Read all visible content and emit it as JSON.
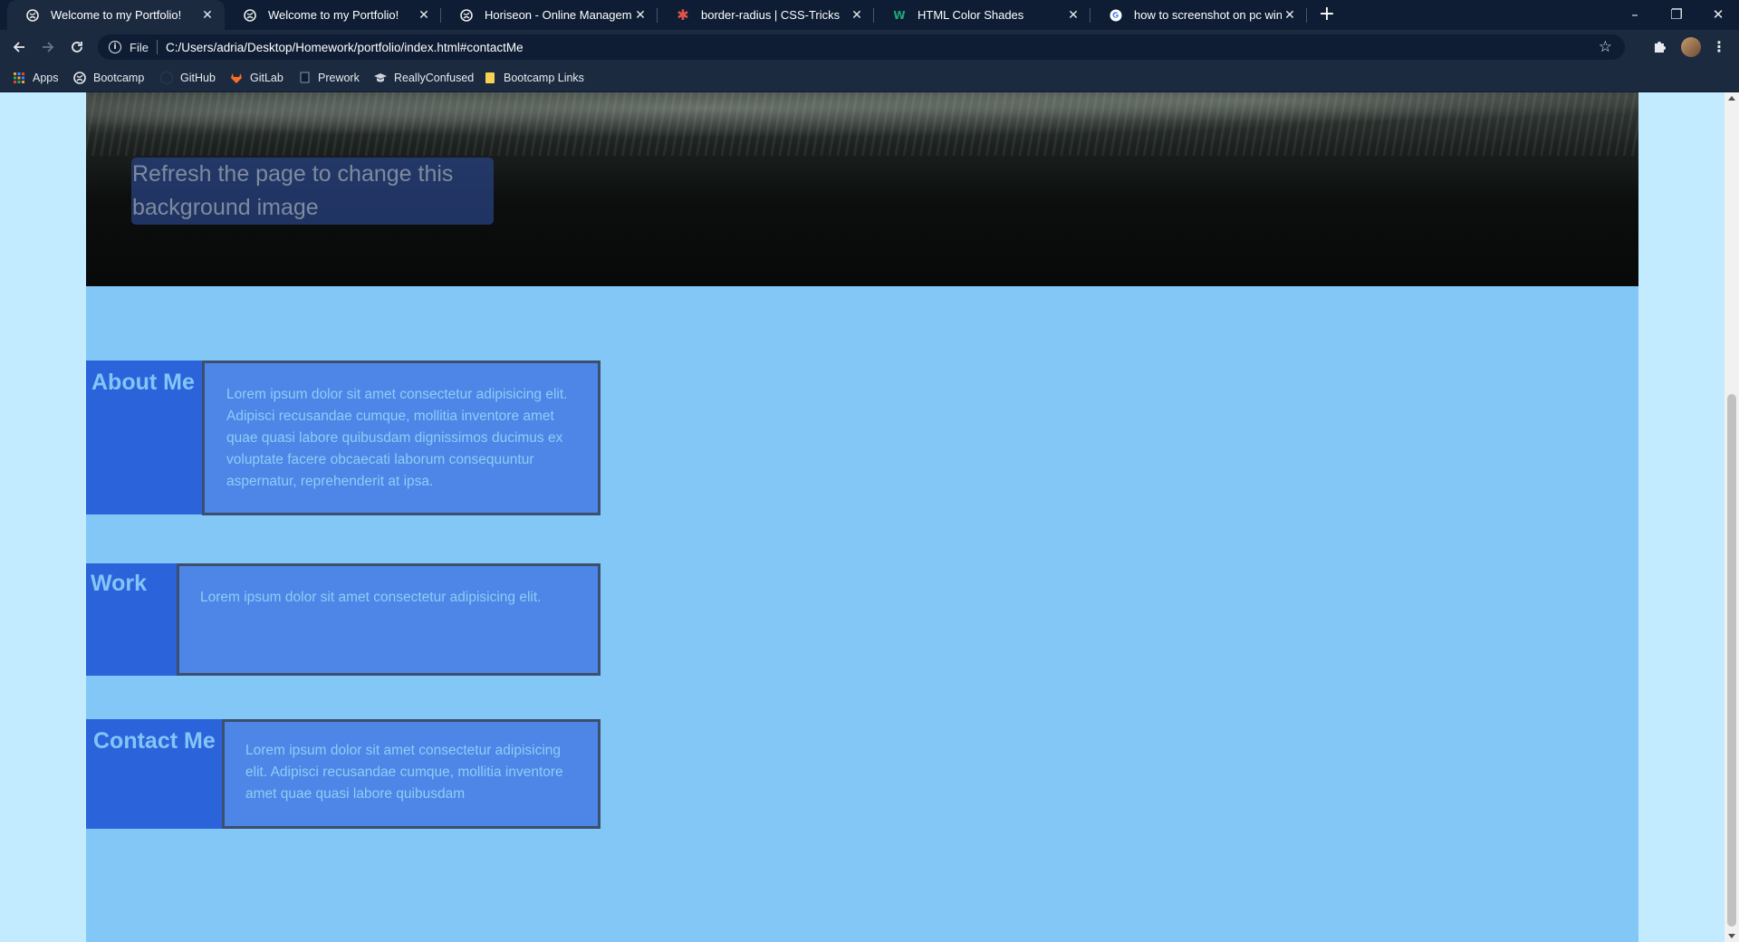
{
  "browser": {
    "tabs": [
      {
        "title": "Welcome to my Portfolio!",
        "icon": "globe-icon",
        "active": true
      },
      {
        "title": "Welcome to my Portfolio!",
        "icon": "globe-icon",
        "active": false
      },
      {
        "title": "Horiseon - Online Management a",
        "icon": "globe-icon",
        "active": false
      },
      {
        "title": "border-radius | CSS-Tricks",
        "icon": "css-tricks-star-icon",
        "active": false
      },
      {
        "title": "HTML Color Shades",
        "icon": "w-logo-icon",
        "active": false
      },
      {
        "title": "how to screenshot on pc window",
        "icon": "google-g-icon",
        "active": false
      }
    ],
    "new_tab": "+",
    "window_controls": {
      "minimize": "–",
      "restore": "❐",
      "close": "✕"
    },
    "address": {
      "scheme_label": "File",
      "url": "C:/Users/adria/Desktop/Homework/portfolio/index.html#contactMe"
    },
    "bookmarks": [
      {
        "label": "Apps",
        "icon": "apps-grid-icon"
      },
      {
        "label": "Bootcamp",
        "icon": "globe-icon"
      },
      {
        "label": "GitHub",
        "icon": "github-icon"
      },
      {
        "label": "GitLab",
        "icon": "gitlab-icon"
      },
      {
        "label": "Prework",
        "icon": "book-icon"
      },
      {
        "label": "ReallyConfused",
        "icon": "graduation-cap-icon"
      },
      {
        "label": "Bootcamp Links",
        "icon": "folder-icon"
      }
    ]
  },
  "page": {
    "hero_caption": "Refresh the page to change this background image",
    "sections": [
      {
        "label": "About Me",
        "body": "Lorem ipsum dolor sit amet consectetur adipisicing elit. Adipisci recusandae cumque, mollitia inventore amet quae quasi labore quibusdam dignissimos ducimus ex voluptate facere obcaecati laborum consequuntur aspernatur, reprehenderit at ipsa."
      },
      {
        "label": "Work",
        "body": "Lorem ipsum dolor sit amet consectetur adipisicing elit."
      },
      {
        "label": "Contact Me",
        "body": "Lorem ipsum dolor sit amet consectetur adipisicing elit. Adipisci recusandae cumque, mollitia inventore amet quae quasi labore quibusdam"
      }
    ]
  },
  "colors": {
    "tabstrip": "#0e1d33",
    "toolbar": "#1c2a40",
    "page_outer": "#c3ebff",
    "page_content": "#82c7f6",
    "section_label": "#2b63db",
    "section_box": "#4d86e6"
  }
}
